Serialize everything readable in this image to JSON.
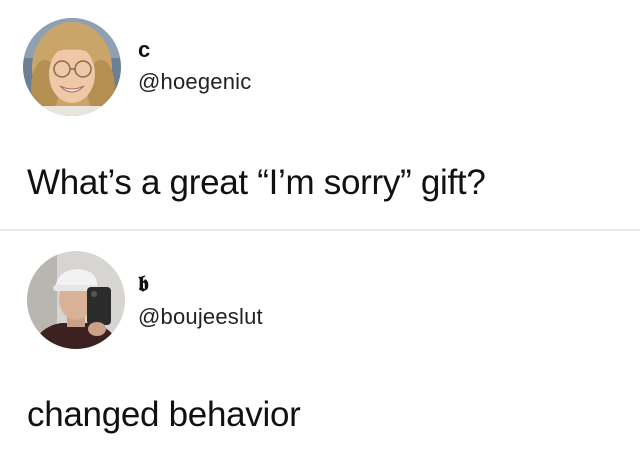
{
  "tweets": [
    {
      "display_name": "c",
      "handle": "@hoegenic",
      "text": "What’s a great “I’m sorry” gift?",
      "avatar": "profile-photo-blonde-woman"
    },
    {
      "display_name": "𝖇",
      "handle": "@boujeeslut",
      "text": "changed behavior",
      "avatar": "profile-photo-man-selfie"
    }
  ],
  "colors": {
    "background": "#ffffff",
    "divider": "#e8e8e8",
    "text": "#111111"
  }
}
